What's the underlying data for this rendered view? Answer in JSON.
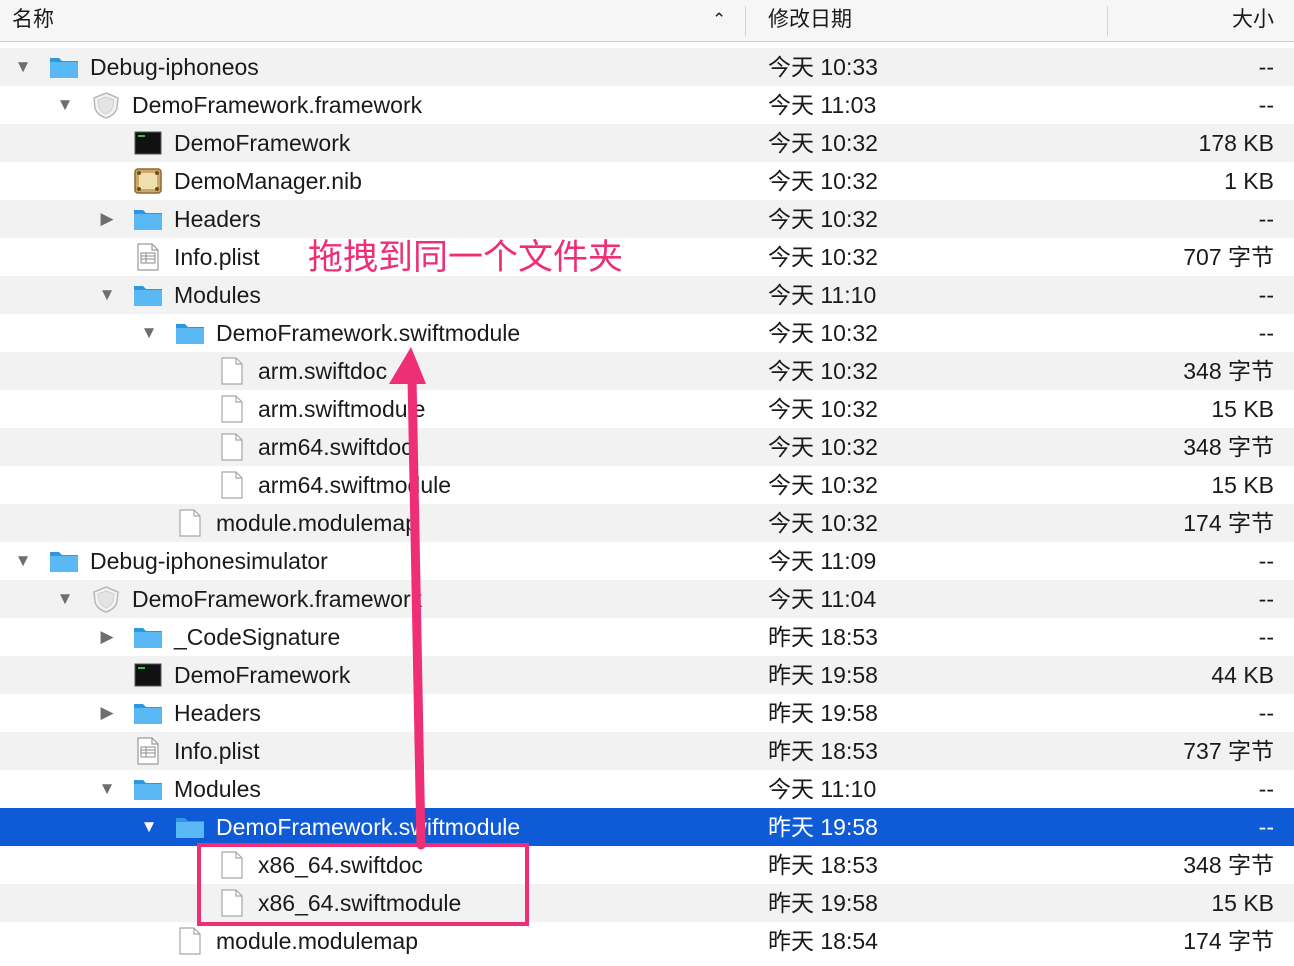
{
  "columns": {
    "name": "名称",
    "date": "修改日期",
    "size": "大小"
  },
  "annotation": {
    "text": "拖拽到同一个文件夹"
  },
  "colors": {
    "selection": "#0f5ad6",
    "annotation": "#ee2f75",
    "folder": "#3eaaf0"
  },
  "rows": [
    {
      "level": 0,
      "disclosure": "open",
      "icon": "folder-icon",
      "name": "Debug-iphoneos",
      "date": "今天 10:33",
      "size": "--"
    },
    {
      "level": 1,
      "disclosure": "open",
      "icon": "framework-icon",
      "name": "DemoFramework.framework",
      "date": "今天 11:03",
      "size": "--"
    },
    {
      "level": 2,
      "disclosure": "none",
      "icon": "executable-icon",
      "name": "DemoFramework",
      "date": "今天 10:32",
      "size": "178 KB"
    },
    {
      "level": 2,
      "disclosure": "none",
      "icon": "nib-icon",
      "name": "DemoManager.nib",
      "date": "今天 10:32",
      "size": "1 KB"
    },
    {
      "level": 2,
      "disclosure": "closed",
      "icon": "folder-icon",
      "name": "Headers",
      "date": "今天 10:32",
      "size": "--"
    },
    {
      "level": 2,
      "disclosure": "none",
      "icon": "plist-icon",
      "name": "Info.plist",
      "date": "今天 10:32",
      "size": "707 字节"
    },
    {
      "level": 2,
      "disclosure": "open",
      "icon": "folder-icon",
      "name": "Modules",
      "date": "今天 11:10",
      "size": "--"
    },
    {
      "level": 3,
      "disclosure": "open",
      "icon": "folder-icon",
      "name": "DemoFramework.swiftmodule",
      "date": "今天 10:32",
      "size": "--"
    },
    {
      "level": 4,
      "disclosure": "none",
      "icon": "document-icon",
      "name": "arm.swiftdoc",
      "date": "今天 10:32",
      "size": "348 字节"
    },
    {
      "level": 4,
      "disclosure": "none",
      "icon": "document-icon",
      "name": "arm.swiftmodule",
      "date": "今天 10:32",
      "size": "15 KB"
    },
    {
      "level": 4,
      "disclosure": "none",
      "icon": "document-icon",
      "name": "arm64.swiftdoc",
      "date": "今天 10:32",
      "size": "348 字节"
    },
    {
      "level": 4,
      "disclosure": "none",
      "icon": "document-icon",
      "name": "arm64.swiftmodule",
      "date": "今天 10:32",
      "size": "15 KB"
    },
    {
      "level": 3,
      "disclosure": "none",
      "icon": "document-icon",
      "name": "module.modulemap",
      "date": "今天 10:32",
      "size": "174 字节"
    },
    {
      "level": 0,
      "disclosure": "open",
      "icon": "folder-icon",
      "name": "Debug-iphonesimulator",
      "date": "今天 11:09",
      "size": "--"
    },
    {
      "level": 1,
      "disclosure": "open",
      "icon": "framework-icon",
      "name": "DemoFramework.framework",
      "date": "今天 11:04",
      "size": "--"
    },
    {
      "level": 2,
      "disclosure": "closed",
      "icon": "folder-icon",
      "name": "_CodeSignature",
      "date": "昨天 18:53",
      "size": "--"
    },
    {
      "level": 2,
      "disclosure": "none",
      "icon": "executable-icon",
      "name": "DemoFramework",
      "date": "昨天 19:58",
      "size": "44 KB"
    },
    {
      "level": 2,
      "disclosure": "closed",
      "icon": "folder-icon",
      "name": "Headers",
      "date": "昨天 19:58",
      "size": "--"
    },
    {
      "level": 2,
      "disclosure": "none",
      "icon": "plist-icon",
      "name": "Info.plist",
      "date": "昨天 18:53",
      "size": "737 字节"
    },
    {
      "level": 2,
      "disclosure": "open",
      "icon": "folder-icon",
      "name": "Modules",
      "date": "今天 11:10",
      "size": "--"
    },
    {
      "level": 3,
      "disclosure": "open",
      "icon": "folder-icon",
      "name": "DemoFramework.swiftmodule",
      "date": "昨天 19:58",
      "size": "--",
      "selected": true
    },
    {
      "level": 4,
      "disclosure": "none",
      "icon": "document-icon",
      "name": "x86_64.swiftdoc",
      "date": "昨天 18:53",
      "size": "348 字节"
    },
    {
      "level": 4,
      "disclosure": "none",
      "icon": "document-icon",
      "name": "x86_64.swiftmodule",
      "date": "昨天 19:58",
      "size": "15 KB"
    },
    {
      "level": 3,
      "disclosure": "none",
      "icon": "document-icon",
      "name": "module.modulemap",
      "date": "昨天 18:54",
      "size": "174 字节"
    }
  ]
}
